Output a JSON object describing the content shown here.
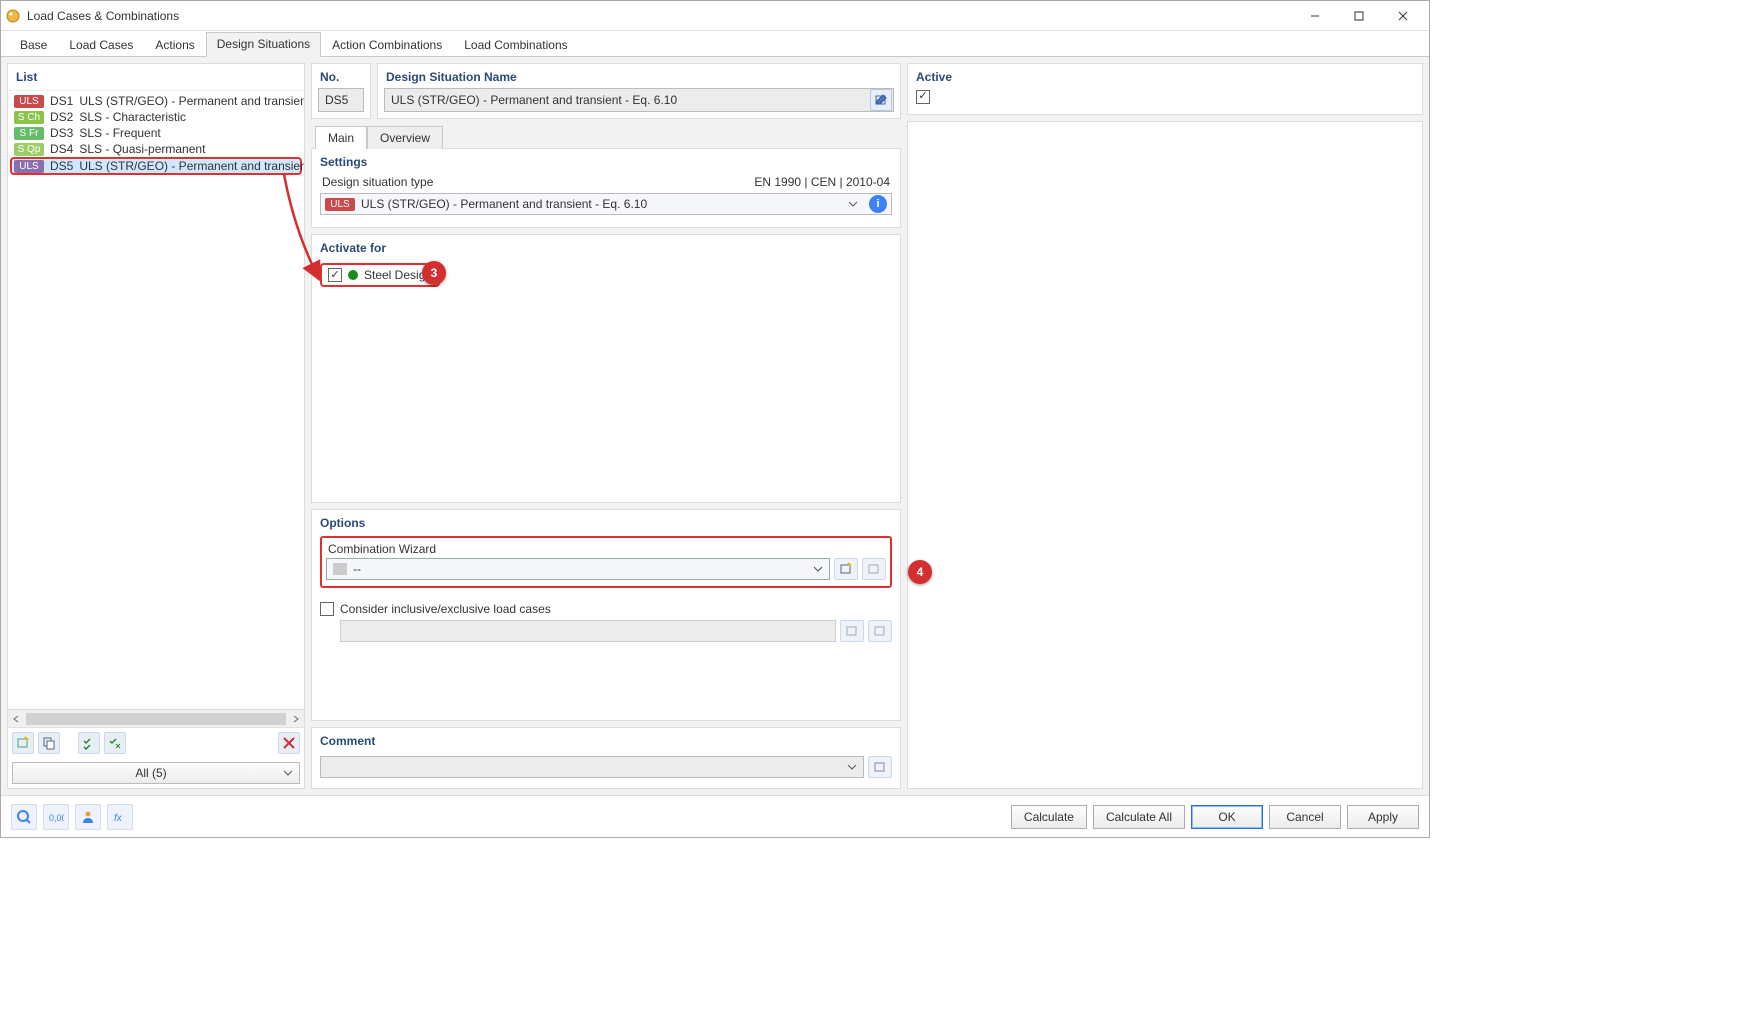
{
  "window": {
    "title": "Load Cases & Combinations"
  },
  "tabs": [
    "Base",
    "Load Cases",
    "Actions",
    "Design Situations",
    "Action Combinations",
    "Load Combinations"
  ],
  "active_tab_index": 3,
  "list": {
    "header": "List",
    "items": [
      {
        "tag": "ULS",
        "tag_cls": "uls",
        "id": "DS1",
        "name": "ULS (STR/GEO) - Permanent and transient - Eq."
      },
      {
        "tag": "S Ch",
        "tag_cls": "sch",
        "id": "DS2",
        "name": "SLS - Characteristic"
      },
      {
        "tag": "S Fr",
        "tag_cls": "sfr",
        "id": "DS3",
        "name": "SLS - Frequent"
      },
      {
        "tag": "S Qp",
        "tag_cls": "sqp",
        "id": "DS4",
        "name": "SLS - Quasi-permanent"
      },
      {
        "tag": "ULS",
        "tag_cls": "uls-sel",
        "id": "DS5",
        "name": "ULS (STR/GEO) - Permanent and transient - Eq."
      }
    ],
    "selected_index": 4,
    "filter": "All (5)"
  },
  "details": {
    "no_label": "No.",
    "no_value": "DS5",
    "name_label": "Design Situation Name",
    "name_value": "ULS (STR/GEO) - Permanent and transient - Eq. 6.10",
    "active_label": "Active",
    "active_checked": true
  },
  "subtabs": [
    "Main",
    "Overview"
  ],
  "active_subtab_index": 0,
  "settings": {
    "header": "Settings",
    "type_label": "Design situation type",
    "type_code": "EN 1990 | CEN | 2010-04",
    "type_tag": "ULS",
    "type_value": "ULS (STR/GEO) - Permanent and transient - Eq. 6.10"
  },
  "activate": {
    "header": "Activate for",
    "steel_label": "Steel Design",
    "steel_checked": true,
    "callout": "3"
  },
  "options": {
    "header": "Options",
    "cw_label": "Combination Wizard",
    "cw_value": "--",
    "consider_label": "Consider inclusive/exclusive load cases",
    "consider_checked": false,
    "callout": "4"
  },
  "comment": {
    "header": "Comment",
    "value": ""
  },
  "footer": {
    "calculate": "Calculate",
    "calculate_all": "Calculate All",
    "ok": "OK",
    "cancel": "Cancel",
    "apply": "Apply"
  }
}
